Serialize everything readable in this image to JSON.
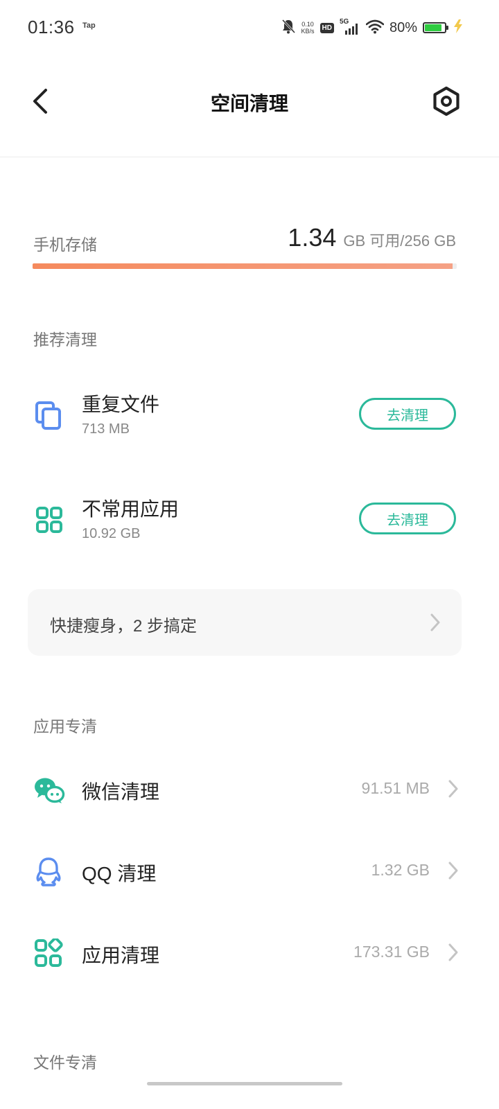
{
  "status_bar": {
    "time": "01:36",
    "tap_label": "Tap",
    "net_speed_value": "0.10",
    "net_speed_unit": "KB/s",
    "hd_label": "HD",
    "network_label": "5G",
    "battery_percent": "80%",
    "battery_level": 0.8,
    "battery_color": "#2ecc40",
    "icons": [
      "mute-bell-icon",
      "signal-icon",
      "wifi-icon",
      "battery-icon",
      "charging-bolt-icon"
    ]
  },
  "header": {
    "title": "空间清理",
    "back_icon": "back-arrow-icon",
    "settings_icon": "settings-icon"
  },
  "storage": {
    "label": "手机存储",
    "available": "1.34",
    "total_text": "GB 可用/256 GB",
    "used_fraction": 0.99,
    "bar_color": "#f58a5d"
  },
  "recommend": {
    "title": "推荐清理",
    "items": [
      {
        "name": "重复文件",
        "size": "713 MB",
        "button": "去清理",
        "icon": "duplicate-files-icon"
      },
      {
        "name": "不常用应用",
        "size": "10.92 GB",
        "button": "去清理",
        "icon": "apps-grid-icon"
      }
    ]
  },
  "quick_slim": {
    "label": "快捷瘦身，2 步搞定"
  },
  "app_clean": {
    "title": "应用专清",
    "items": [
      {
        "name": "微信清理",
        "size": "91.51 MB",
        "icon": "wechat-icon"
      },
      {
        "name": "QQ 清理",
        "size": "1.32 GB",
        "icon": "qq-icon"
      },
      {
        "name": "应用清理",
        "size": "173.31 GB",
        "icon": "apps-icon"
      }
    ]
  },
  "file_clean": {
    "title": "文件专清"
  },
  "colors": {
    "accent": "#2bb99a",
    "icon_blue": "#5b8def",
    "icon_teal": "#2bb99a"
  }
}
